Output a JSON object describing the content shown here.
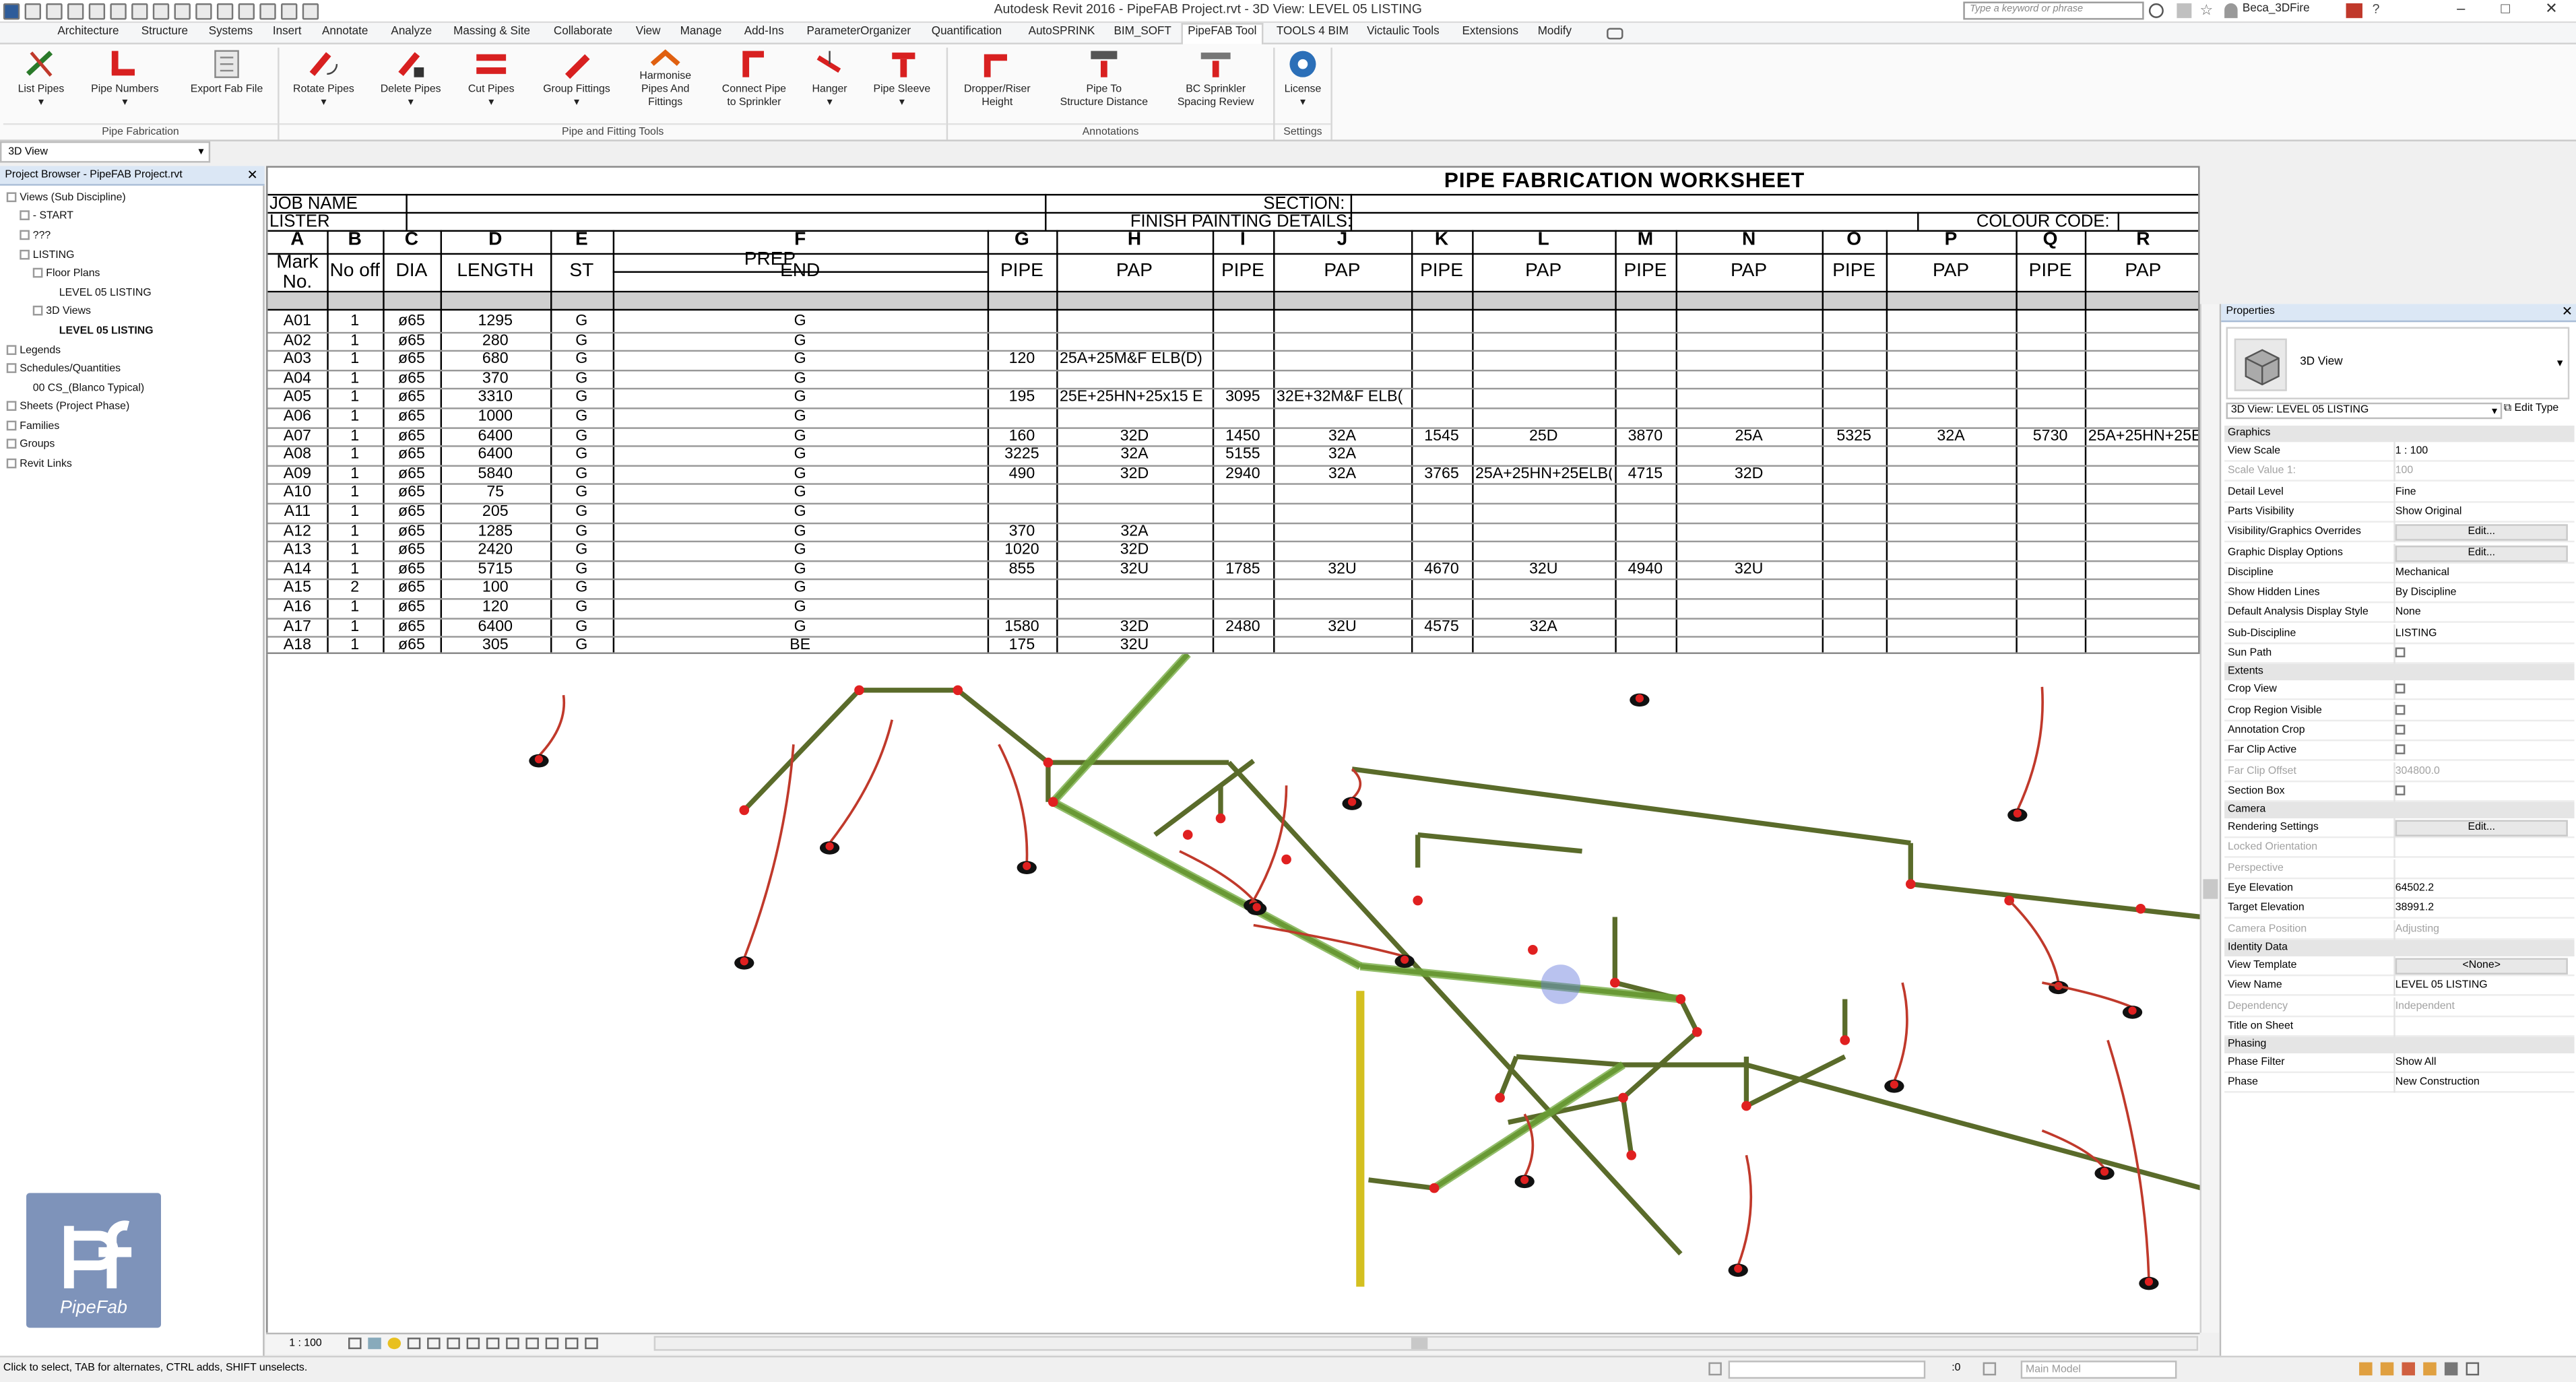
{
  "window": {
    "title": "Autodesk Revit 2016 -     PipeFAB Project.rvt - 3D View: LEVEL 05 LISTING",
    "search_placeholder": "Type a keyword or phrase",
    "user": "Beca_3DFire"
  },
  "ribbon_tabs": [
    "Architecture",
    "Structure",
    "Systems",
    "Insert",
    "Annotate",
    "Analyze",
    "Massing & Site",
    "Collaborate",
    "View",
    "Manage",
    "Add-Ins",
    "ParameterOrganizer",
    "Quantification",
    "AutoSPRINK",
    "BIM_SOFT",
    "PipeFAB Tool",
    "TOOLS 4 BIM",
    "Victaulic Tools",
    "Extensions",
    "Modify"
  ],
  "ribbon_active_tab": "PipeFAB Tool",
  "ribbon_buttons": [
    {
      "l1": "List Pipes",
      "l2": ""
    },
    {
      "l1": "Pipe Numbers",
      "l2": ""
    },
    {
      "l1": "Export Fab File",
      "l2": ""
    },
    {
      "l1": "Rotate Pipes",
      "l2": ""
    },
    {
      "l1": "Delete Pipes",
      "l2": ""
    },
    {
      "l1": "Cut Pipes",
      "l2": ""
    },
    {
      "l1": "Group Fittings",
      "l2": ""
    },
    {
      "l1": "Harmonise",
      "l2": "Pipes And",
      "l3": "Fittings"
    },
    {
      "l1": "Connect Pipe",
      "l2": "to Sprinkler"
    },
    {
      "l1": "Hanger",
      "l2": ""
    },
    {
      "l1": "Pipe Sleeve",
      "l2": ""
    },
    {
      "l1": "Dropper/Riser",
      "l2": "Height"
    },
    {
      "l1": "Pipe To",
      "l2": "Structure Distance"
    },
    {
      "l1": "BC Sprinkler",
      "l2": "Spacing Review"
    },
    {
      "l1": "License",
      "l2": ""
    }
  ],
  "ribbon_panels": [
    "Pipe Fabrication",
    "Pipe and Fitting Tools",
    "Annotations",
    "Settings"
  ],
  "view_selector": "3D View",
  "project_browser": {
    "title": "Project Browser - PipeFAB Project.rvt",
    "items": [
      {
        "label": "Views (Sub Discipline)",
        "bold": false
      },
      {
        "label": "- START",
        "bold": false
      },
      {
        "label": "???",
        "bold": false
      },
      {
        "label": "LISTING",
        "bold": false
      },
      {
        "label": "Floor Plans",
        "bold": false
      },
      {
        "label": "LEVEL 05 LISTING",
        "bold": false
      },
      {
        "label": "3D Views",
        "bold": false
      },
      {
        "label": "LEVEL 05 LISTING",
        "bold": true
      },
      {
        "label": "Legends",
        "bold": false
      },
      {
        "label": "Schedules/Quantities",
        "bold": false
      },
      {
        "label": "00 CS_(Blanco Typical)",
        "bold": false
      },
      {
        "label": "Sheets (Project Phase)",
        "bold": false
      },
      {
        "label": "Families",
        "bold": false
      },
      {
        "label": "Groups",
        "bold": false
      },
      {
        "label": "Revit Links",
        "bold": false
      }
    ]
  },
  "logo_text": "PipeFab",
  "worksheet": {
    "title": "PIPE FABRICATION WORKSHEET",
    "job_name": "JOB NAME",
    "lister": "LISTER",
    "section": "SECTION:",
    "finish_painting": "FINISH PAINTING DETAILS:",
    "colour_code": "COLOUR CODE:",
    "col_letters": [
      "A",
      "B",
      "C",
      "D",
      "E",
      "F",
      "G",
      "H",
      "I",
      "J",
      "K",
      "L",
      "M",
      "N",
      "O",
      "P",
      "Q",
      "R"
    ],
    "col_heads": [
      "Mark No.",
      "No off",
      "DIA",
      "LENGTH",
      "ST",
      "END",
      "PIPE",
      "PAP",
      "PIPE",
      "PAP",
      "PIPE",
      "PAP",
      "PIPE",
      "PAP",
      "PIPE",
      "PAP",
      "PIPE",
      "PAP"
    ],
    "prep_label": "PREP",
    "rows": [
      [
        "A01",
        "1",
        "ø65",
        "1295",
        "G",
        "G",
        "",
        "",
        "",
        "",
        "",
        "",
        "",
        "",
        "",
        "",
        "",
        ""
      ],
      [
        "A02",
        "1",
        "ø65",
        "280",
        "G",
        "G",
        "",
        "",
        "",
        "",
        "",
        "",
        "",
        "",
        "",
        "",
        "",
        ""
      ],
      [
        "A03",
        "1",
        "ø65",
        "680",
        "G",
        "G",
        "120",
        "25A+25M&F ELB(D)",
        "",
        "",
        "",
        "",
        "",
        "",
        "",
        "",
        "",
        ""
      ],
      [
        "A04",
        "1",
        "ø65",
        "370",
        "G",
        "G",
        "",
        "",
        "",
        "",
        "",
        "",
        "",
        "",
        "",
        "",
        "",
        ""
      ],
      [
        "A05",
        "1",
        "ø65",
        "3310",
        "G",
        "G",
        "195",
        "25E+25HN+25x15 E",
        "3095",
        "32E+32M&F ELB(",
        "",
        "",
        "",
        "",
        "",
        "",
        "",
        ""
      ],
      [
        "A06",
        "1",
        "ø65",
        "1000",
        "G",
        "G",
        "",
        "",
        "",
        "",
        "",
        "",
        "",
        "",
        "",
        "",
        "",
        ""
      ],
      [
        "A07",
        "1",
        "ø65",
        "6400",
        "G",
        "G",
        "160",
        "32D",
        "1450",
        "32A",
        "1545",
        "25D",
        "3870",
        "25A",
        "5325",
        "32A",
        "5730",
        "25A+25HN+25E"
      ],
      [
        "A08",
        "1",
        "ø65",
        "6400",
        "G",
        "G",
        "3225",
        "32A",
        "5155",
        "32A",
        "",
        "",
        "",
        "",
        "",
        "",
        "",
        ""
      ],
      [
        "A09",
        "1",
        "ø65",
        "5840",
        "G",
        "G",
        "490",
        "32D",
        "2940",
        "32A",
        "3765",
        "25A+25HN+25ELB(",
        "4715",
        "32D",
        "",
        "",
        "",
        ""
      ],
      [
        "A10",
        "1",
        "ø65",
        "75",
        "G",
        "G",
        "",
        "",
        "",
        "",
        "",
        "",
        "",
        "",
        "",
        "",
        "",
        ""
      ],
      [
        "A11",
        "1",
        "ø65",
        "205",
        "G",
        "G",
        "",
        "",
        "",
        "",
        "",
        "",
        "",
        "",
        "",
        "",
        "",
        ""
      ],
      [
        "A12",
        "1",
        "ø65",
        "1285",
        "G",
        "G",
        "370",
        "32A",
        "",
        "",
        "",
        "",
        "",
        "",
        "",
        "",
        "",
        ""
      ],
      [
        "A13",
        "1",
        "ø65",
        "2420",
        "G",
        "G",
        "1020",
        "32D",
        "",
        "",
        "",
        "",
        "",
        "",
        "",
        "",
        "",
        ""
      ],
      [
        "A14",
        "1",
        "ø65",
        "5715",
        "G",
        "G",
        "855",
        "32U",
        "1785",
        "32U",
        "4670",
        "32U",
        "4940",
        "32U",
        "",
        "",
        "",
        ""
      ],
      [
        "A15",
        "2",
        "ø65",
        "100",
        "G",
        "G",
        "",
        "",
        "",
        "",
        "",
        "",
        "",
        "",
        "",
        "",
        "",
        ""
      ],
      [
        "A16",
        "1",
        "ø65",
        "120",
        "G",
        "G",
        "",
        "",
        "",
        "",
        "",
        "",
        "",
        "",
        "",
        "",
        "",
        ""
      ],
      [
        "A17",
        "1",
        "ø65",
        "6400",
        "G",
        "G",
        "1580",
        "32D",
        "2480",
        "32U",
        "4575",
        "32A",
        "",
        "",
        "",
        "",
        "",
        ""
      ],
      [
        "A18",
        "1",
        "ø65",
        "305",
        "G",
        "BE",
        "175",
        "32U",
        "",
        "",
        "",
        "",
        "",
        "",
        "",
        "",
        "",
        ""
      ]
    ]
  },
  "view_scale_label": "1 : 100",
  "properties": {
    "title": "Properties",
    "type_name": "3D View",
    "instance": "3D View: LEVEL 05 LISTING",
    "edit_type": "Edit Type",
    "groups": [
      {
        "name": "Graphics",
        "rows": [
          {
            "n": "View Scale",
            "v": "1 : 100",
            "kind": "text",
            "dim": false
          },
          {
            "n": "Scale Value    1:",
            "v": "100",
            "kind": "text",
            "dim": true
          },
          {
            "n": "Detail Level",
            "v": "Fine",
            "kind": "text",
            "dim": false
          },
          {
            "n": "Parts Visibility",
            "v": "Show Original",
            "kind": "text",
            "dim": false
          },
          {
            "n": "Visibility/Graphics Overrides",
            "v": "Edit...",
            "kind": "button",
            "dim": false
          },
          {
            "n": "Graphic Display Options",
            "v": "Edit...",
            "kind": "button",
            "dim": false
          },
          {
            "n": "Discipline",
            "v": "Mechanical",
            "kind": "text",
            "dim": false
          },
          {
            "n": "Show Hidden Lines",
            "v": "By Discipline",
            "kind": "text",
            "dim": false
          },
          {
            "n": "Default Analysis Display Style",
            "v": "None",
            "kind": "text",
            "dim": false
          },
          {
            "n": "Sub-Discipline",
            "v": "LISTING",
            "kind": "text",
            "dim": false
          },
          {
            "n": "Sun Path",
            "v": "",
            "kind": "check",
            "dim": false
          }
        ]
      },
      {
        "name": "Extents",
        "rows": [
          {
            "n": "Crop View",
            "v": "",
            "kind": "check",
            "dim": false
          },
          {
            "n": "Crop Region Visible",
            "v": "",
            "kind": "check",
            "dim": false
          },
          {
            "n": "Annotation Crop",
            "v": "",
            "kind": "check",
            "dim": false
          },
          {
            "n": "Far Clip Active",
            "v": "",
            "kind": "check",
            "dim": false
          },
          {
            "n": "Far Clip Offset",
            "v": "304800.0",
            "kind": "text",
            "dim": true
          },
          {
            "n": "Section Box",
            "v": "",
            "kind": "check",
            "dim": false
          }
        ]
      },
      {
        "name": "Camera",
        "rows": [
          {
            "n": "Rendering Settings",
            "v": "Edit...",
            "kind": "button",
            "dim": false
          },
          {
            "n": "Locked Orientation",
            "v": "",
            "kind": "text",
            "dim": true
          },
          {
            "n": "Perspective",
            "v": "",
            "kind": "text",
            "dim": true
          },
          {
            "n": "Eye Elevation",
            "v": "64502.2",
            "kind": "text",
            "dim": false
          },
          {
            "n": "Target Elevation",
            "v": "38991.2",
            "kind": "text",
            "dim": false
          },
          {
            "n": "Camera Position",
            "v": "Adjusting",
            "kind": "text",
            "dim": true
          }
        ]
      },
      {
        "name": "Identity Data",
        "rows": [
          {
            "n": "View Template",
            "v": "<None>",
            "kind": "button",
            "dim": false
          },
          {
            "n": "View Name",
            "v": "LEVEL 05 LISTING",
            "kind": "text",
            "dim": false
          },
          {
            "n": "Dependency",
            "v": "Independent",
            "kind": "text",
            "dim": true
          },
          {
            "n": "Title on Sheet",
            "v": "",
            "kind": "text",
            "dim": false
          }
        ]
      },
      {
        "name": "Phasing",
        "rows": [
          {
            "n": "Phase Filter",
            "v": "Show All",
            "kind": "text",
            "dim": false
          },
          {
            "n": "Phase",
            "v": "New Construction",
            "kind": "text",
            "dim": false
          }
        ]
      }
    ]
  },
  "status": {
    "text": "Click to select, TAB for alternates, CTRL adds, SHIFT unselects.",
    "zoom": ":0",
    "model": "Main Model"
  },
  "colors": {
    "pipe": "#5a6b2a",
    "pipe_highlight": "#6fa83a",
    "fitting": "#e02020",
    "riser": "#d4c020",
    "drop_line": "#c0392b"
  }
}
